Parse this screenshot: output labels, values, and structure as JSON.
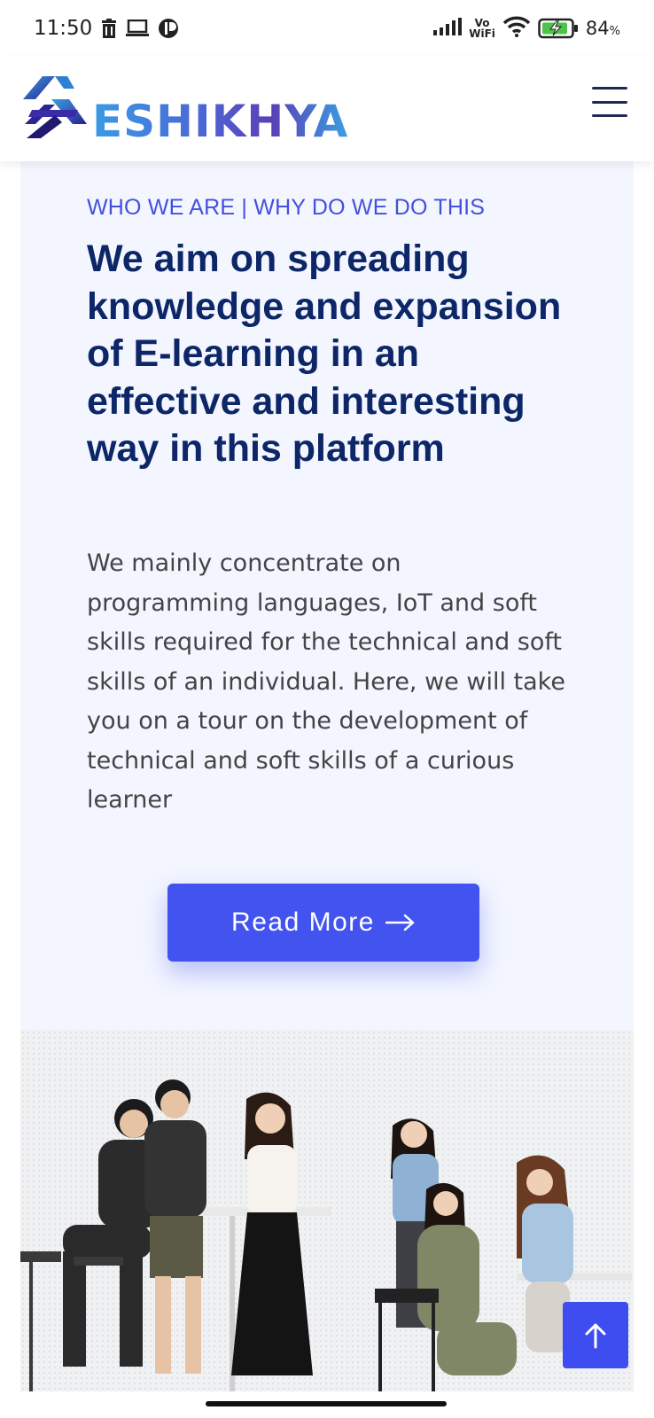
{
  "status_bar": {
    "time": "11:50",
    "network_label_top": "Vo",
    "network_label_bottom": "WiFi",
    "battery_percent": "84",
    "battery_unit": "%"
  },
  "header": {
    "logo_text": "ESHIKHYA",
    "menu_icon": "hamburger-menu-icon",
    "brand_colors": [
      "#3a9be3",
      "#5b3fb8",
      "#1c2a55"
    ]
  },
  "about": {
    "eyebrow": "WHO WE ARE | WHY DO WE DO THIS",
    "headline": "We aim on spreading knowledge and expansion of E-learning in an effective and interesting way in this platform",
    "paragraph": "We mainly concentrate on programming languages, IoT and soft skills required for the technical and soft skills of an individual. Here, we will take you on a tour on the development of technical and soft skills of a curious learner",
    "cta_label": "Read More",
    "cta_icon": "arrow-right-icon",
    "accent_color": "#4353f0",
    "headline_color": "#0d2668"
  },
  "photo": {
    "icon": "team-photo"
  },
  "back_to_top": {
    "icon": "arrow-up-icon"
  }
}
